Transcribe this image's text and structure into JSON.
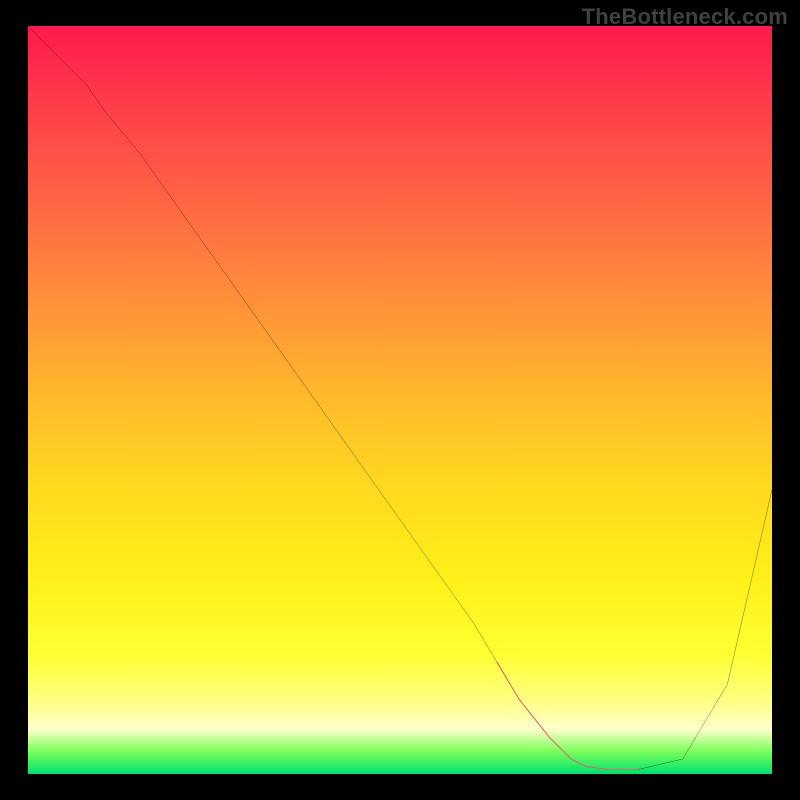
{
  "watermark": "TheBottleneck.com",
  "chart_data": {
    "type": "line",
    "title": "",
    "xlabel": "",
    "ylabel": "",
    "xlim": [
      0,
      100
    ],
    "ylim": [
      0,
      100
    ],
    "grid": false,
    "legend": false,
    "series": [
      {
        "name": "bottleneck-curve",
        "color": "#000000",
        "x": [
          0,
          4,
          8,
          10,
          15,
          20,
          25,
          30,
          35,
          40,
          45,
          50,
          55,
          60,
          63,
          66,
          70,
          73,
          75,
          78,
          82,
          88,
          94,
          100
        ],
        "y": [
          100,
          96,
          92,
          89,
          83,
          76,
          69,
          62,
          55,
          48,
          41,
          34,
          27,
          20,
          15,
          10,
          5,
          2,
          1,
          0.6,
          0.6,
          2,
          12,
          38
        ]
      },
      {
        "name": "optimal-range-highlight",
        "color": "#d86a6a",
        "x": [
          63,
          66,
          70,
          73,
          75,
          78,
          82
        ],
        "y": [
          15,
          10,
          5,
          2,
          1,
          0.6,
          0.6
        ]
      }
    ],
    "annotations": []
  },
  "colors": {
    "frame": "#000000",
    "watermark": "#404040",
    "curve": "#000000",
    "highlight": "#d86a6a"
  }
}
